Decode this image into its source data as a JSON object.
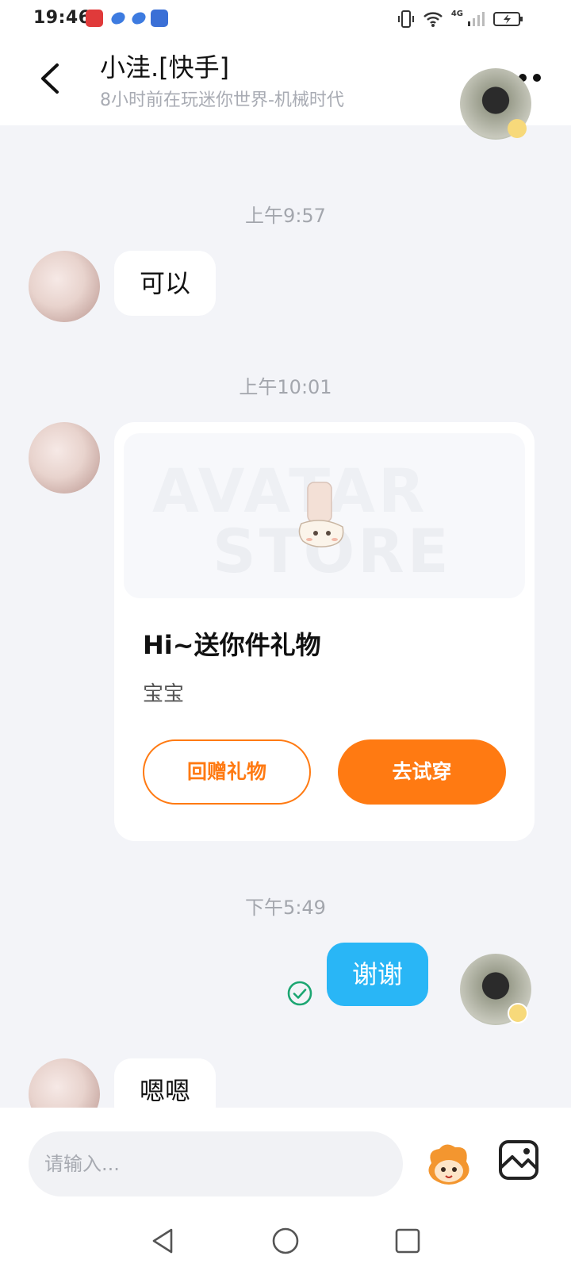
{
  "status_bar": {
    "time": "19:46",
    "network": "4G"
  },
  "header": {
    "title": "小洼.[快手]",
    "subtitle": "8小时前在玩迷你世界-机械时代"
  },
  "messages": {
    "ts1": "上午9:57",
    "msg1": "可以",
    "ts2": "上午10:01",
    "gift_card": {
      "watermark_line1": "AVATAR",
      "watermark_line2": "STORE",
      "title": "Hi~送你件礼物",
      "subtitle": "宝宝",
      "return_gift_label": "回赠礼物",
      "try_on_label": "去试穿"
    },
    "ts3": "下午5:49",
    "msg_out": "谢谢",
    "msg2": "嗯嗯"
  },
  "input": {
    "placeholder": "请输入..."
  },
  "colors": {
    "accent_orange": "#ff7a12",
    "outgoing_bubble": "#29b6f6",
    "read_check": "#1ca672"
  },
  "icons": [
    "back-arrow-icon",
    "more-icon",
    "read-check-icon",
    "emoji-icon",
    "image-icon",
    "nav-back-icon",
    "nav-home-icon",
    "nav-recents-icon"
  ]
}
